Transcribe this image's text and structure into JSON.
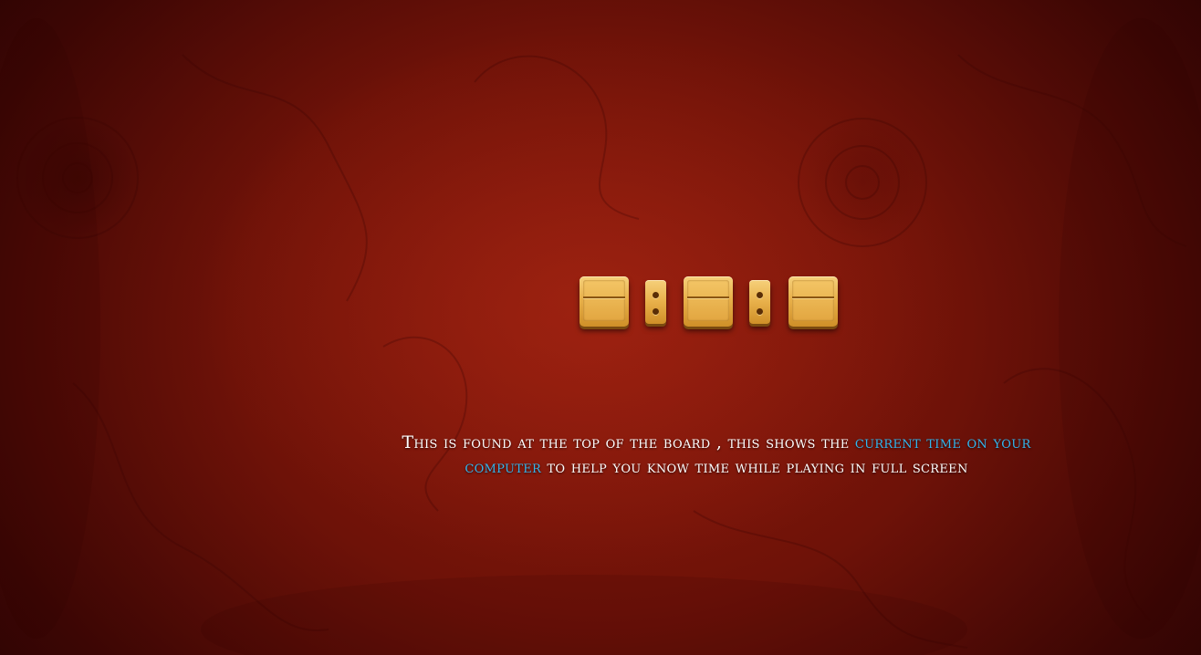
{
  "theme": {
    "background_color": "#7a150a",
    "tile_color": "#e8b04a",
    "highlight_color": "#33b6ee",
    "text_color": "#ffffff"
  },
  "clock": {
    "hours": "",
    "minutes": "",
    "seconds": "",
    "separator_icon": "colon-dots-icon"
  },
  "caption": {
    "part1": "This is found at the top of the board , this shows the",
    "highlight": "current time on your computer",
    "part2": "to help you know time while playing in full screen"
  }
}
